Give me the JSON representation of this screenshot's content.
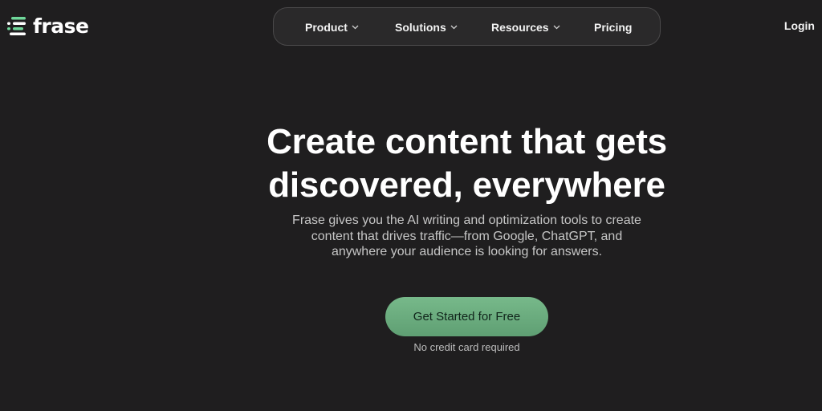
{
  "brand": {
    "name": "frase",
    "logo_icon": "frase-logo-icon",
    "logo_colors": [
      "#6fd89a",
      "#ffffff",
      "#6fd89a"
    ]
  },
  "nav": {
    "items": [
      {
        "label": "Product",
        "has_dropdown": true
      },
      {
        "label": "Solutions",
        "has_dropdown": true
      },
      {
        "label": "Resources",
        "has_dropdown": true
      },
      {
        "label": "Pricing",
        "has_dropdown": false
      }
    ],
    "login_label": "Login"
  },
  "hero": {
    "title_line1": "Create content that gets",
    "title_line2": "discovered, everywhere",
    "subtitle_line1": "Frase gives you the AI writing and optimization tools to create",
    "subtitle_line2": "content that drives traffic—from Google, ChatGPT, and",
    "subtitle_line3": "anywhere your audience is looking for answers.",
    "cta_label": "Get Started for Free",
    "cta_note": "No credit card required"
  },
  "colors": {
    "background": "#1f1e1f",
    "accent": "#6aab7e",
    "nav_border": "#4a494a"
  }
}
